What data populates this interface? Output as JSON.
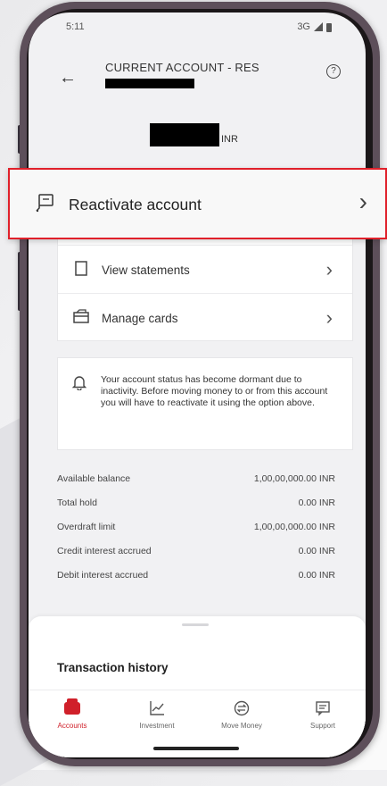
{
  "status_bar": {
    "time": "5:11",
    "network": "3G"
  },
  "header": {
    "title": "CURRENT ACCOUNT - RES",
    "back_icon": "arrow-left-icon",
    "help_icon": "help-circle-icon"
  },
  "balance": {
    "currency": "INR"
  },
  "menu": {
    "highlighted": {
      "label": "Reactivate account",
      "icon": "reactivate-account-icon"
    },
    "items": [
      {
        "label": "View statements",
        "icon": "document-icon"
      },
      {
        "label": "Manage cards",
        "icon": "card-icon"
      }
    ]
  },
  "notice": {
    "text": "Your account status has become dormant due to inactivity. Before moving money to or from this account you will have to reactivate it using the option above.",
    "icon": "bell-icon"
  },
  "details": [
    {
      "label": "Available balance",
      "value": "1,00,00,000.00 INR"
    },
    {
      "label": "Total hold",
      "value": "0.00 INR"
    },
    {
      "label": "Overdraft limit",
      "value": "1,00,00,000.00 INR"
    },
    {
      "label": "Credit interest accrued",
      "value": "0.00 INR"
    },
    {
      "label": "Debit interest accrued",
      "value": "0.00 INR"
    }
  ],
  "transactions": {
    "title": "Transaction history"
  },
  "bottom_nav": [
    {
      "label": "Accounts",
      "icon": "wallet-icon",
      "active": true
    },
    {
      "label": "Investment",
      "icon": "chart-icon",
      "active": false
    },
    {
      "label": "Move Money",
      "icon": "currency-exchange-icon",
      "active": false
    },
    {
      "label": "Support",
      "icon": "chat-icon",
      "active": false
    }
  ],
  "colors": {
    "accent": "#d0202a",
    "highlight_border": "#e0202a"
  }
}
